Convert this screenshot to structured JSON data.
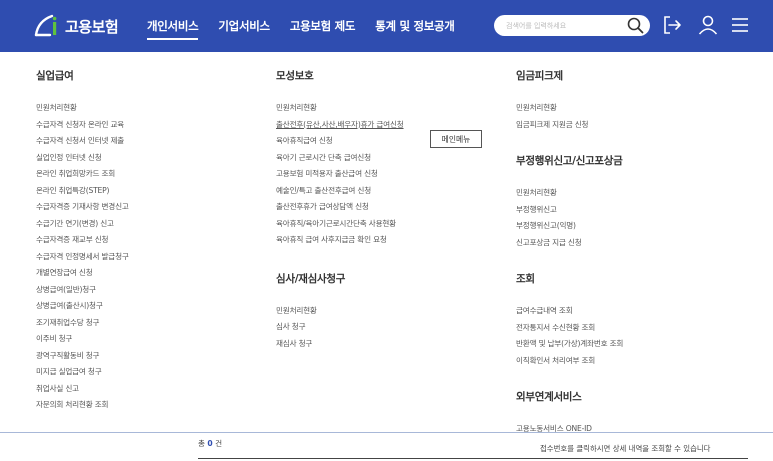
{
  "header": {
    "logo_text": "고용보험",
    "nav": [
      {
        "label": "개인서비스",
        "active": true
      },
      {
        "label": "기업서비스",
        "active": false
      },
      {
        "label": "고용보험 제도",
        "active": false
      },
      {
        "label": "통계 및 정보공개",
        "active": false
      }
    ],
    "search_placeholder": "검색어를 입력하세요",
    "bg_color": "#2f4db0"
  },
  "columns": {
    "col1": {
      "sections": [
        {
          "title": "실업급여",
          "items": [
            "민원처리현황",
            "수급자격 신청자 온라인 교육",
            "수급자격 신청서 인터넷 제출",
            "실업인정 인터넷 신청",
            "온라인 취업희망카드 조회",
            "온라인 취업특강(STEP)",
            "수급자격증 기재사항 변경신고",
            "수급기간 연기(변경) 신고",
            "수급자격증 재교부 신청",
            "수급자격 인정명세서 발급청구",
            "개별연장급여 신청",
            "상병급여(일반)청구",
            "상병급여(출산시)청구",
            "조기재취업수당 청구",
            "이주비 청구",
            "광역구직활동비 청구",
            "미지급 실업급여 청구",
            "취업사실 신고",
            "자문의회 처리현황 조회"
          ]
        }
      ]
    },
    "col2": {
      "sections": [
        {
          "title": "모성보호",
          "items": [
            "민원처리현황",
            "출산전후(유산,사산,배우자)휴가 급여신청",
            "육아휴직급여 신청",
            "육아기 근로시간 단축 급여신청",
            "고용보험 미적용자 출산급여 신청",
            "예술인/특고 출산전후급여 신청",
            "출산전후휴가 급여상담액 신청",
            "육아휴직/육아기근로시간단축 사용현황",
            "육아휴직 급여 사후지급금 확인 요청"
          ]
        },
        {
          "title": "심사/재심사청구",
          "items": [
            "민원처리현황",
            "심사 청구",
            "재심사 청구"
          ]
        }
      ]
    },
    "col3": {
      "sections": [
        {
          "title": "임금피크제",
          "items": [
            "민원처리현황",
            "임금피크제 지원금 신청"
          ]
        },
        {
          "title": "부정행위신고/신고포상금",
          "items": [
            "민원처리현황",
            "부정행위신고",
            "부정행위신고(익명)",
            "신고포상금 지급 신청"
          ]
        },
        {
          "title": "조회",
          "items": [
            "급여수급내역 조회",
            "전자통지서 수신현황 조회",
            "반환액 및 납부(가상)계좌번호 조회",
            "이직확인서 처리여부 조회"
          ]
        },
        {
          "title": "외부연계서비스",
          "items": [
            "고용노동서비스 ONE-ID"
          ]
        }
      ]
    }
  },
  "tooltip": "메인메뉴",
  "footer": {
    "total_prefix": "총",
    "total_count": "0",
    "total_suffix": "건",
    "notice": "접수번호를 클릭하시면 상세 내역을 조회할 수 있습니다"
  }
}
